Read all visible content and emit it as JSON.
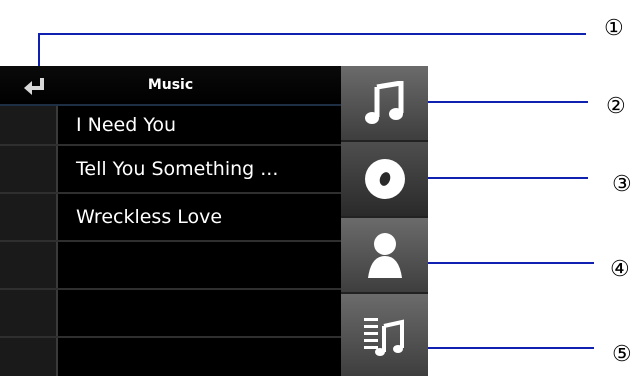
{
  "header": {
    "title": "Music"
  },
  "songs": [
    {
      "title": "I Need You"
    },
    {
      "title": "Tell You Something ..."
    },
    {
      "title": "Wreckless Love"
    },
    {
      "title": ""
    },
    {
      "title": ""
    },
    {
      "title": ""
    }
  ],
  "sidebar_tabs": [
    {
      "icon": "music-note-icon"
    },
    {
      "icon": "disc-icon"
    },
    {
      "icon": "artist-icon"
    },
    {
      "icon": "playlist-icon"
    }
  ],
  "callouts": [
    "①",
    "②",
    "③",
    "④",
    "⑤"
  ],
  "colors": {
    "callout_line": "#1020b0",
    "header_border": "#1e2f44"
  }
}
